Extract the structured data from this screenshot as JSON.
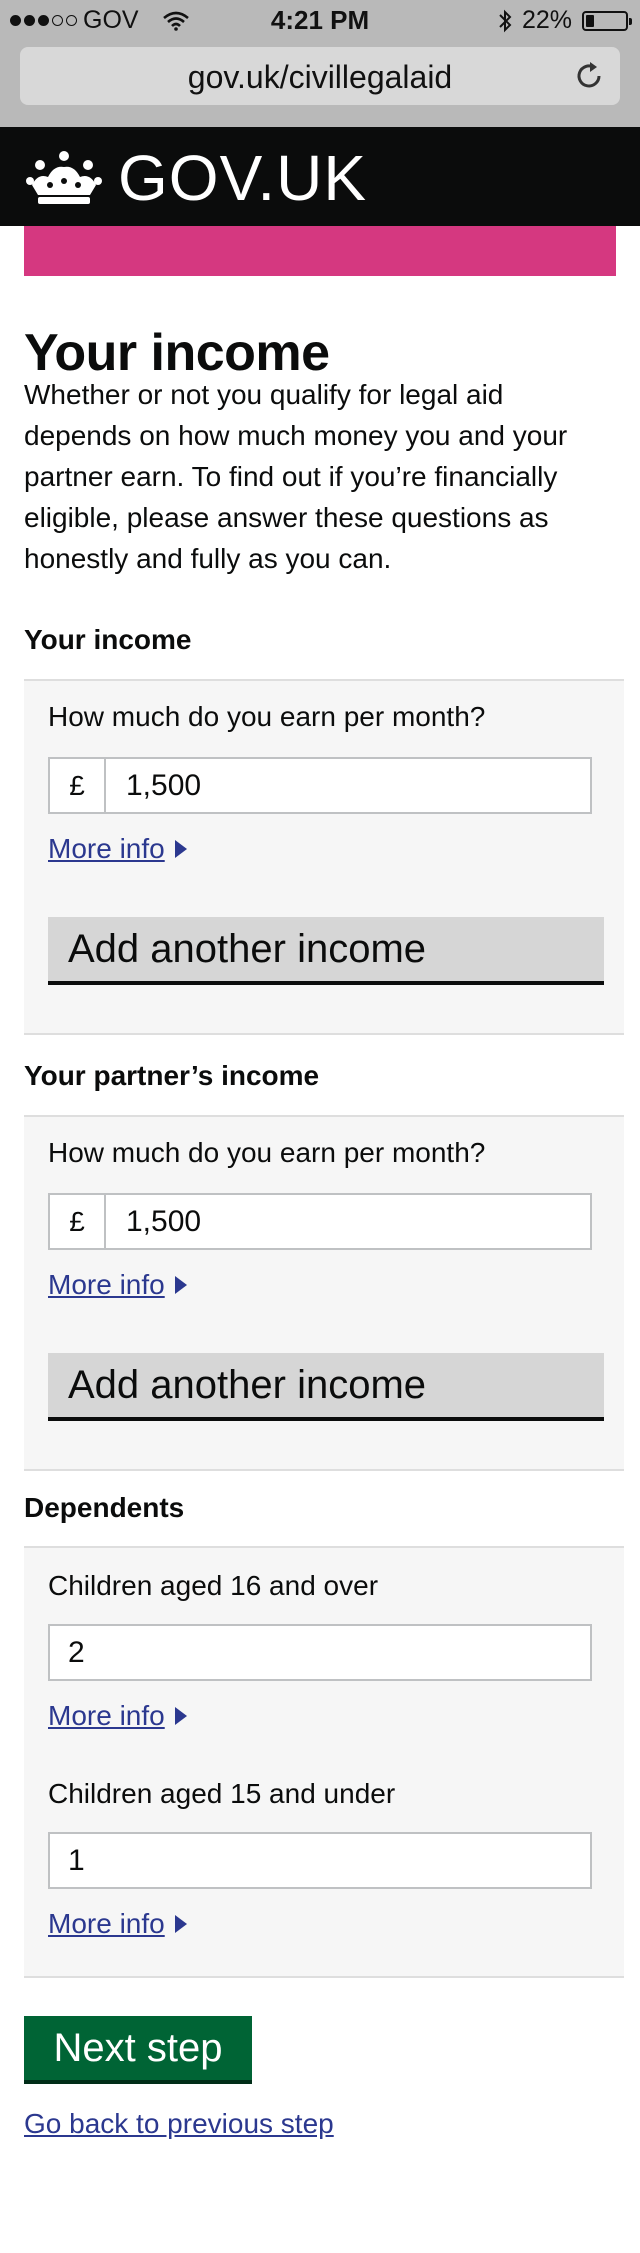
{
  "status_bar": {
    "carrier": "GOV",
    "time": "4:21 PM",
    "battery_percent": "22%",
    "battery_level": 0.22,
    "icons": [
      "signal-dots-icon",
      "wifi-icon",
      "bluetooth-icon",
      "battery-icon"
    ]
  },
  "browser": {
    "url": "gov.uk/civillegalaid",
    "reload_icon": "reload-icon"
  },
  "header": {
    "logo_text": "GOV.UK",
    "crown_icon": "crown-icon",
    "phase_color": "#d53880"
  },
  "page": {
    "title": "Your income",
    "intro": "Whether or not you qualify for legal aid depends on how much money you and your partner earn. To find out if you’re financially eligible, please answer these questions as honestly and fully as you can."
  },
  "your_income": {
    "heading": "Your income",
    "question": "How much do you earn per month?",
    "currency": "£",
    "value": "1,500",
    "more_info": "More info",
    "add_button": "Add another income"
  },
  "partner_income": {
    "heading": "Your partner’s income",
    "question": "How much do you earn per month?",
    "currency": "£",
    "value": "1,500",
    "more_info": "More info",
    "add_button": "Add another income"
  },
  "dependents": {
    "heading": "Dependents",
    "q1": "Children aged 16 and over",
    "v1": "2",
    "more_info_1": "More info",
    "q2": "Children aged 15 and under",
    "v2": "1",
    "more_info_2": "More info"
  },
  "actions": {
    "next": "Next step",
    "back": "Go back to previous step",
    "next_color": "#006435",
    "link_color": "#2b388f"
  }
}
